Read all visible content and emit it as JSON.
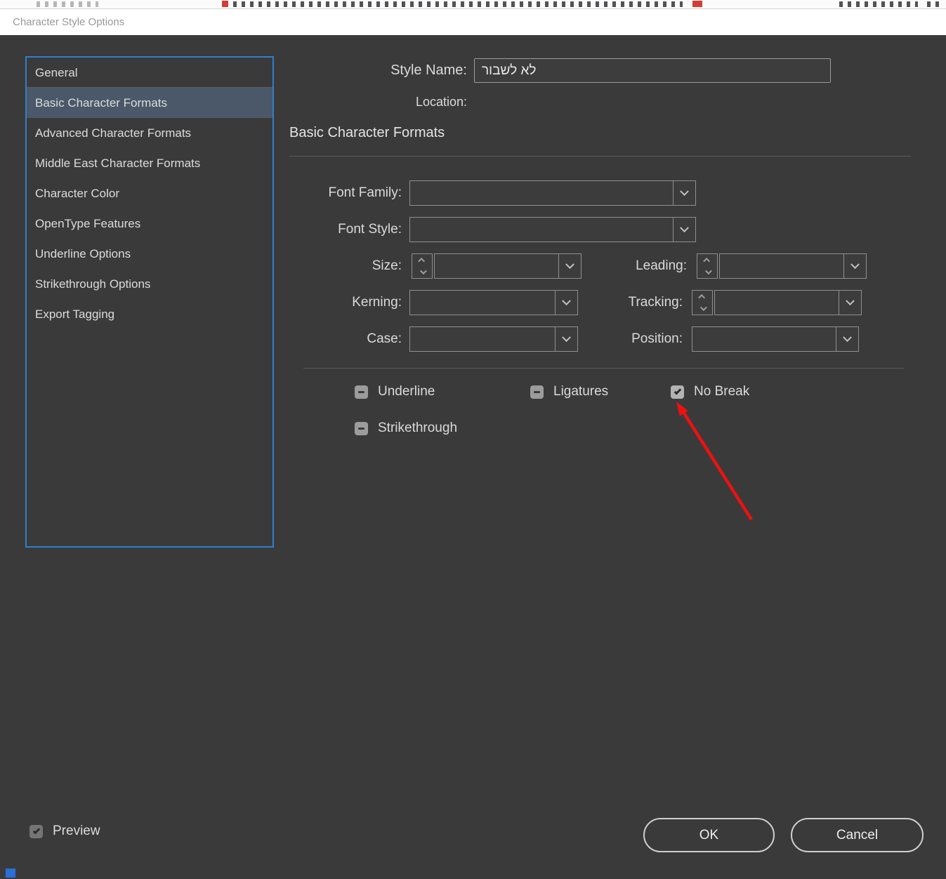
{
  "window": {
    "title": "Character Style Options"
  },
  "sidebar": {
    "items": [
      {
        "label": "General",
        "selected": false
      },
      {
        "label": "Basic Character Formats",
        "selected": true
      },
      {
        "label": "Advanced Character Formats",
        "selected": false
      },
      {
        "label": "Middle East Character Formats",
        "selected": false
      },
      {
        "label": "Character Color",
        "selected": false
      },
      {
        "label": "OpenType Features",
        "selected": false
      },
      {
        "label": "Underline Options",
        "selected": false
      },
      {
        "label": "Strikethrough Options",
        "selected": false
      },
      {
        "label": "Export Tagging",
        "selected": false
      }
    ]
  },
  "header": {
    "style_name_label": "Style Name:",
    "style_name_value": "לא לשבור",
    "location_label": "Location:",
    "section_title": "Basic Character Formats"
  },
  "fields": {
    "font_family": {
      "label": "Font Family:",
      "value": ""
    },
    "font_style": {
      "label": "Font Style:",
      "value": ""
    },
    "size": {
      "label": "Size:",
      "value": ""
    },
    "leading": {
      "label": "Leading:",
      "value": ""
    },
    "kerning": {
      "label": "Kerning:",
      "value": ""
    },
    "tracking": {
      "label": "Tracking:",
      "value": ""
    },
    "case": {
      "label": "Case:",
      "value": ""
    },
    "position": {
      "label": "Position:",
      "value": ""
    }
  },
  "checkboxes": [
    {
      "label": "Underline",
      "state": "indeterminate"
    },
    {
      "label": "Ligatures",
      "state": "indeterminate"
    },
    {
      "label": "No Break",
      "state": "checked"
    },
    {
      "label": "Strikethrough",
      "state": "indeterminate"
    }
  ],
  "footer": {
    "preview_label": "Preview",
    "preview_checked": true,
    "ok_label": "OK",
    "cancel_label": "Cancel"
  },
  "colors": {
    "dialog_bg": "#3a3a3a",
    "sidebar_selected": "#4a5869",
    "accent_blue": "#2f7fd0",
    "annotation_red": "#ee1111"
  }
}
